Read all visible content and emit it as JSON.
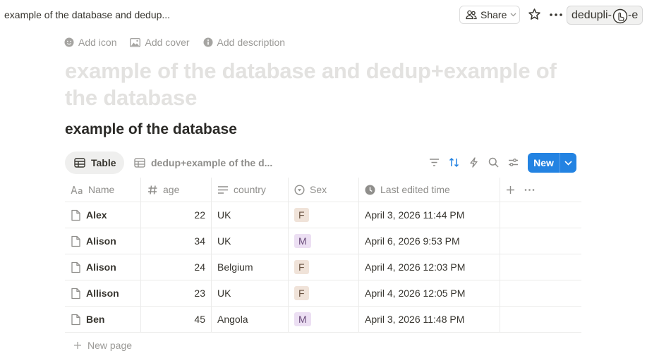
{
  "topbar": {
    "breadcrumb": "example of the database and dedup...",
    "share_label": "Share",
    "badge_label": "dedupli-",
    "badge_suffix": "-e"
  },
  "page_actions": {
    "add_icon": "Add icon",
    "add_cover": "Add cover",
    "add_description": "Add description"
  },
  "page_title": "example of the database and dedup+example of the database",
  "database_title": "example of the database",
  "views": {
    "table_label": "Table",
    "dedup_label": "dedup+example of the d..."
  },
  "toolbar": {
    "new_label": "New",
    "accent_color": "#2383e2",
    "icons": [
      "filter-icon",
      "sort-icon",
      "automation-icon",
      "search-icon",
      "settings-icon"
    ]
  },
  "columns": {
    "name": "Name",
    "age": "age",
    "country": "country",
    "sex": "Sex",
    "edited": "Last edited time"
  },
  "rows": [
    {
      "name": "Alex",
      "age": "22",
      "country": "UK",
      "sex": "F",
      "edited": "April 3, 2026 11:44 PM"
    },
    {
      "name": "Alison",
      "age": "34",
      "country": "UK",
      "sex": "M",
      "edited": "April 6, 2026 9:53 PM"
    },
    {
      "name": "Alison",
      "age": "24",
      "country": "Belgium",
      "sex": "F",
      "edited": "April 4, 2026 12:03 PM"
    },
    {
      "name": "Allison",
      "age": "23",
      "country": "UK",
      "sex": "F",
      "edited": "April 4, 2026 12:05 PM"
    },
    {
      "name": "Ben",
      "age": "45",
      "country": "Angola",
      "sex": "M",
      "edited": "April 3, 2026 11:48 PM"
    }
  ],
  "new_page_label": "New page",
  "tag_colors": {
    "F": "#f0e3d9",
    "M": "#ecdff3"
  }
}
